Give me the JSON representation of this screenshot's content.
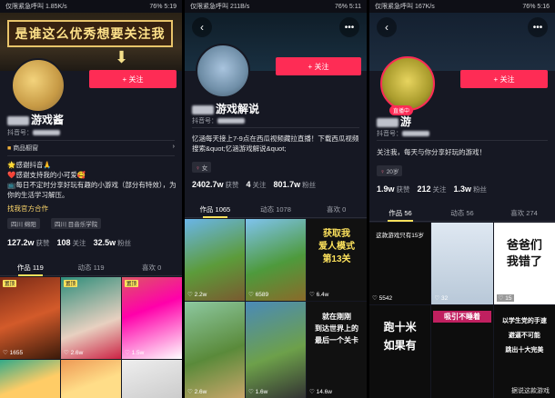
{
  "p1": {
    "status_left": "仅限紧急呼叫 1.85K/s",
    "status_right": "76% 5:19",
    "banner_text": "是谁这么优秀想要关注我",
    "follow": "+ 关注",
    "name_suffix": "游戏酱",
    "uid_label": "抖音号：",
    "shop_label": "商品橱窗",
    "bio_lines": [
      "🌟感谢抖音🙏",
      "❤️感谢支持我的小可爱🥰",
      "📺每日不定时分享好玩有趣的小游戏（部分有特效），为你的生活学习解压。",
      ""
    ],
    "bio_link": "找我官方合作",
    "tags": [
      "四川 绵阳",
      "四川 目音乐学院"
    ],
    "stats": [
      {
        "num": "127.2w",
        "label": "获赞"
      },
      {
        "num": "108",
        "label": "关注"
      },
      {
        "num": "32.5w",
        "label": "粉丝"
      }
    ],
    "tabs": [
      "作品 119",
      "动态 119",
      "喜欢 0"
    ],
    "videos": [
      {
        "pin": "置顶",
        "likes": "1655"
      },
      {
        "pin": "置顶",
        "likes": "2.6w"
      },
      {
        "pin": "置顶",
        "likes": "1.5w"
      },
      {
        "likes": ""
      },
      {
        "likes": ""
      },
      {
        "likes": ""
      }
    ]
  },
  "p2": {
    "status_left": "仅限紧急呼叫 211B/s",
    "status_right": "76% 5:11",
    "follow": "+ 关注",
    "name_suffix": "游戏解说",
    "uid_label": "抖音号：",
    "bio": "忆涵每天接上7-9点在西瓜视频藏拉直播！下载西瓜视频搜索&quot;忆涵游戏解说&quot;",
    "gender": "女",
    "stats": [
      {
        "num": "2402.7w",
        "label": "获赞"
      },
      {
        "num": "4",
        "label": "关注"
      },
      {
        "num": "801.7w",
        "label": "粉丝"
      }
    ],
    "tabs": [
      "作品 1065",
      "动态 1078",
      "喜欢 0"
    ],
    "videos": [
      {
        "likes": "2.2w",
        "cap": ""
      },
      {
        "likes": "6589",
        "cap": ""
      },
      {
        "likes": "6.4w",
        "cap": "获取我\n爱人模式\n第13关"
      },
      {
        "likes": "2.6w",
        "cap": ""
      },
      {
        "likes": "1.6w",
        "cap": ""
      },
      {
        "likes": "14.6w",
        "cap": "就在刚刚\n到达世界上的\n最后一个关卡"
      }
    ]
  },
  "p3": {
    "status_left": "仅限紧急呼叫 167K/s",
    "status_right": "76% 5:16",
    "live": "直播中",
    "follow": "+ 关注",
    "name_suffix": "游",
    "uid_label": "抖音号：",
    "bio": "关注我，每天与你分享好玩的游戏！",
    "age": "20岁",
    "stats": [
      {
        "num": "1.9w",
        "label": "获赞"
      },
      {
        "num": "212",
        "label": "关注"
      },
      {
        "num": "1.3w",
        "label": "粉丝"
      }
    ],
    "tabs": [
      "作品 56",
      "动态 56",
      "喜欢 274"
    ],
    "videos": [
      {
        "likes": "5542",
        "cap": "这款游戏只有15岁"
      },
      {
        "likes": "32",
        "cap": ""
      },
      {
        "likes": "15",
        "cap": "爸爸们\n我错了"
      },
      {
        "likes": "",
        "cap": "跑十米\n如果有"
      },
      {
        "likes": "",
        "cap": "吸引不睡着"
      },
      {
        "likes": "",
        "cap": "以学生党的手速\n避逼不可能\n跳出十大完美"
      }
    ],
    "watermark": "据说这款游戏"
  }
}
